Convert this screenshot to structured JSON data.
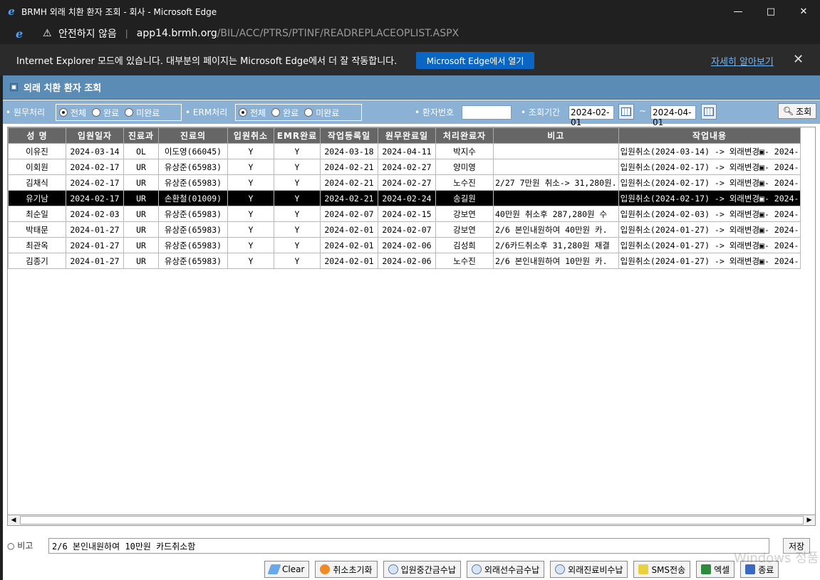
{
  "window": {
    "title": "BRMH 외래 치환 환자 조회 - 회사 - Microsoft Edge"
  },
  "addressbar": {
    "security": "안전하지 않음",
    "host": "app14.brmh.org",
    "path": "/BIL/ACC/PTRS/PTINF/READREPLACEOPLIST.ASPX"
  },
  "iebar": {
    "message": "Internet Explorer 모드에 있습니다. 대부분의 페이지는 Microsoft Edge에서 더 잘 작동합니다.",
    "open_label": "Microsoft Edge에서 열기",
    "learn_label": "자세히 알아보기"
  },
  "page": {
    "title": "외래 치환 환자 조회"
  },
  "filter": {
    "work_label": "원무처리",
    "erm_label": "ERM처리",
    "patient_label": "환자번호",
    "period_label": "조회기간",
    "opt_all": "전체",
    "opt_done": "완료",
    "opt_notdone": "미완료",
    "patient_value": "",
    "date_from": "2024-02-01",
    "date_to": "2024-04-01",
    "tilde": "~",
    "search_label": "조회"
  },
  "grid": {
    "headers": [
      "성 명",
      "입원일자",
      "진료과",
      "진료의",
      "입원취소",
      "EMR완료",
      "작업등록일",
      "원무완료일",
      "처리완료자",
      "비고",
      "작업내용"
    ],
    "rows": [
      [
        "이유진",
        "2024-03-14",
        "OL",
        "이도영(66045)",
        "Y",
        "Y",
        "2024-03-18",
        "2024-04-11",
        "박지수",
        "",
        "입원취소(2024-03-14) -> 외래변경▣- 2024-"
      ],
      [
        "이회원",
        "2024-02-17",
        "UR",
        "유상준(65983)",
        "Y",
        "Y",
        "2024-02-21",
        "2024-02-27",
        "양미영",
        "",
        "입원취소(2024-02-17) -> 외래변경▣- 2024-"
      ],
      [
        "김채식",
        "2024-02-17",
        "UR",
        "유상준(65983)",
        "Y",
        "Y",
        "2024-02-21",
        "2024-02-27",
        "노수진",
        "2/27 7만원 취소-> 31,280원.",
        "입원취소(2024-02-17) -> 외래변경▣- 2024-"
      ],
      [
        "유기남",
        "2024-02-17",
        "UR",
        "손환철(01009)",
        "Y",
        "Y",
        "2024-02-21",
        "2024-02-24",
        "송길원",
        "",
        "입원취소(2024-02-17) -> 외래변경▣- 2024-"
      ],
      [
        "최순일",
        "2024-02-03",
        "UR",
        "유상준(65983)",
        "Y",
        "Y",
        "2024-02-07",
        "2024-02-15",
        "강보연",
        "40만원 취소후 287,280원 수",
        "입원취소(2024-02-03) -> 외래변경▣- 2024-"
      ],
      [
        "박태문",
        "2024-01-27",
        "UR",
        "유상준(65983)",
        "Y",
        "Y",
        "2024-02-01",
        "2024-02-07",
        "강보연",
        "2/6 본인내원하여 40만원 카.",
        "입원취소(2024-01-27) -> 외래변경▣- 2024-"
      ],
      [
        "최관옥",
        "2024-01-27",
        "UR",
        "유상준(65983)",
        "Y",
        "Y",
        "2024-02-01",
        "2024-02-06",
        "김성희",
        "2/6카드취소후 31,280원 재결",
        "입원취소(2024-01-27) -> 외래변경▣- 2024-"
      ],
      [
        "김종기",
        "2024-01-27",
        "UR",
        "유상준(65983)",
        "Y",
        "Y",
        "2024-02-01",
        "2024-02-06",
        "노수진",
        "2/6 본인내원하여 10만원 카.",
        "입원취소(2024-01-27) -> 외래변경▣- 2024-"
      ]
    ],
    "selected_row": 3
  },
  "bottom": {
    "memo_label": "비고",
    "memo_value": "2/6 본인내원하여 10만원 카드취소함",
    "save_label": "저장",
    "buttons": [
      "Clear",
      "취소초기화",
      "입원중간금수납",
      "외래선수금수납",
      "외래진료비수납",
      "SMS전송",
      "엑셀",
      "종료"
    ]
  },
  "colors": {
    "header_bar": "#5b8cb6",
    "filter_bar": "#8bb1d4",
    "grid_header": "#666666",
    "selected_row": "#000000",
    "edge_button": "#0a66c2"
  },
  "watermark": "Windows 정품 인증"
}
